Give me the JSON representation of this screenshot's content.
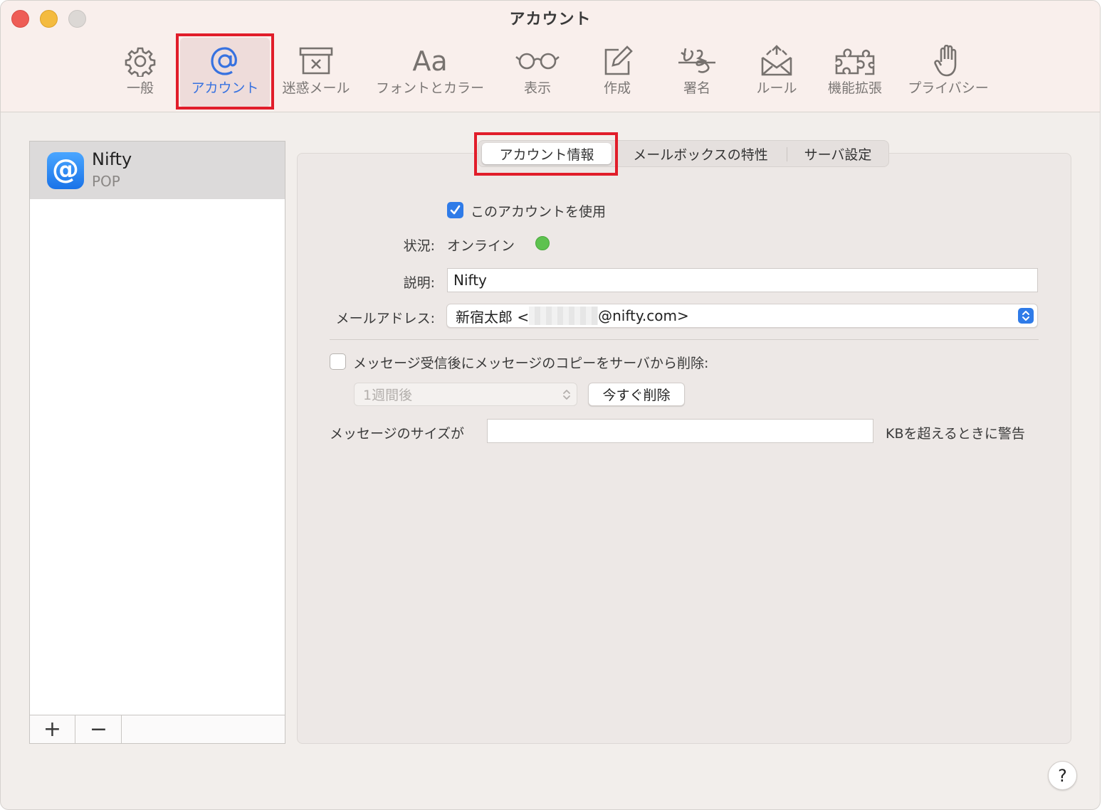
{
  "window": {
    "title": "アカウント"
  },
  "toolbar": {
    "items": [
      {
        "label": "一般",
        "icon": "gear-icon"
      },
      {
        "label": "アカウント",
        "icon": "at-icon"
      },
      {
        "label": "迷惑メール",
        "icon": "junk-icon"
      },
      {
        "label": "フォントとカラー",
        "icon_text": "Aa"
      },
      {
        "label": "表示",
        "icon": "glasses-icon"
      },
      {
        "label": "作成",
        "icon": "compose-icon"
      },
      {
        "label": "署名",
        "icon": "signature-icon"
      },
      {
        "label": "ルール",
        "icon": "rules-envelope-icon"
      },
      {
        "label": "機能拡張",
        "icon": "puzzle-icon"
      },
      {
        "label": "プライバシー",
        "icon": "hand-icon"
      }
    ],
    "selected": "アカウント"
  },
  "sidebar": {
    "accounts": [
      {
        "name": "Nifty",
        "type": "POP",
        "icon_glyph": "@"
      }
    ],
    "add_label": "+",
    "remove_label": "−"
  },
  "tabs": {
    "items": [
      "アカウント情報",
      "メールボックスの特性",
      "サーバ設定"
    ],
    "selected": "アカウント情報"
  },
  "form": {
    "use_account_label": "このアカウントを使用",
    "use_account_checked": true,
    "status_label": "状況:",
    "status_value": "オンライン",
    "description_label": "説明:",
    "description_value": "Nifty",
    "email_label": "メールアドレス:",
    "email_prefix": "新宿太郎 <",
    "email_suffix": "@nifty.com>",
    "delete_copy_label": "メッセージ受信後にメッセージのコピーをサーバから削除:",
    "delete_copy_checked": false,
    "delete_after_value": "1週間後",
    "delete_now_label": "今すぐ削除",
    "size_warning_prefix": "メッセージのサイズが",
    "size_warning_value": "",
    "size_warning_suffix": "KBを超えるときに警告"
  },
  "help": {
    "label": "?"
  },
  "colors": {
    "accent": "#2f7be8",
    "highlight_box": "#e11d2a",
    "status_online": "#5dc24f"
  }
}
